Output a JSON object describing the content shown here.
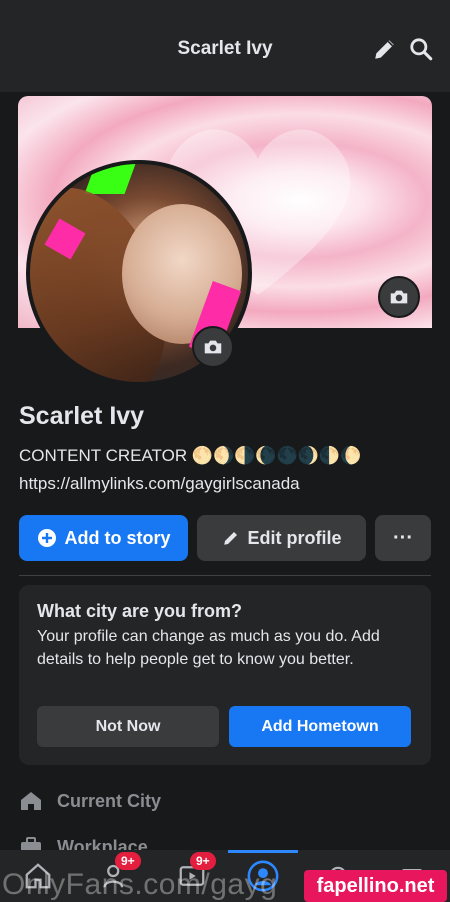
{
  "header": {
    "title": "Scarlet Ivy"
  },
  "profile": {
    "name": "Scarlet Ivy",
    "bio": "CONTENT CREATOR 🌕🌖🌗🌘🌑🌒🌓🌔",
    "link": "https://allmylinks.com/gaygirlscanada"
  },
  "actions": {
    "add_story": "Add to story",
    "edit_profile": "Edit profile",
    "more": "···"
  },
  "prompt_card": {
    "title": "What city are you from?",
    "body": "Your profile can change as much as you do. Add details to help people get to know you better.",
    "dismiss": "Not Now",
    "confirm": "Add Hometown"
  },
  "details": {
    "current_city": "Current City",
    "workplace": "Workplace"
  },
  "tabbar": {
    "friends_badge": "9+",
    "watch_badge": "9+"
  },
  "watermarks": {
    "left": "OnlyFans.com/gayg",
    "right": "fapellino.net"
  },
  "colors": {
    "accent": "#1877f2",
    "background": "#18191a",
    "surface": "#242526",
    "badge": "#e41e3f"
  }
}
